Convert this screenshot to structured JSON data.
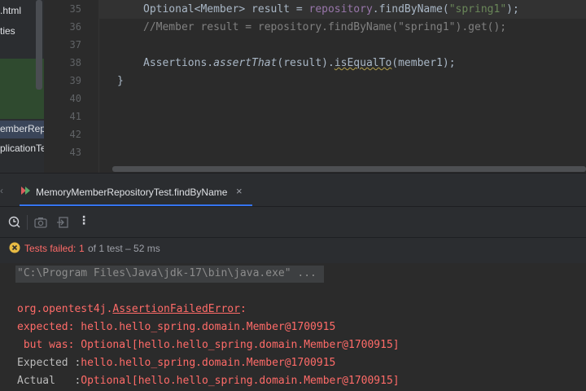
{
  "project_tree": {
    "items": [
      ".html",
      "ties",
      "emberRepo",
      "plicationTe"
    ]
  },
  "editor": {
    "line_numbers": [
      "35",
      "36",
      "37",
      "38",
      "39",
      "40",
      "41",
      "42",
      "43"
    ],
    "line35": {
      "a": "Optional<Member> result = ",
      "b": "repository",
      "c": ".findByName(",
      "d": "\"spring1\"",
      "e": ");"
    },
    "line36": "//Member result = repository.findByName(\"spring1\").get();",
    "line38": {
      "a": "Assertions.",
      "b": "assertThat",
      "c": "(result).",
      "d": "isEqualTo",
      "e": "(member1);"
    },
    "line39": "}"
  },
  "run_panel": {
    "tab_title": "MemoryMemberRepositoryTest.findByName",
    "status_label": "Tests failed:",
    "status_count": "1",
    "status_detail": "of 1 test – 52 ms",
    "console": {
      "command": "\"C:\\Program Files\\Java\\jdk-17\\bin\\java.exe\" ...",
      "error_prefix": "org.opentest4j.",
      "error_class": "AssertionFailedError",
      "error_suffix": ":",
      "expected_line": "expected: hello.hello_spring.domain.Member@1700915",
      "butwas_line": " but was: Optional[hello.hello_spring.domain.Member@1700915]",
      "expected_label": "Expected :",
      "expected_value": "hello.hello_spring.domain.Member@1700915",
      "actual_label": "Actual   :",
      "actual_value": "Optional[hello.hello_spring.domain.Member@1700915]"
    }
  },
  "colors": {
    "error_red": "#ff6b68",
    "string_green": "#6a8759",
    "field_purple": "#9876aa"
  }
}
